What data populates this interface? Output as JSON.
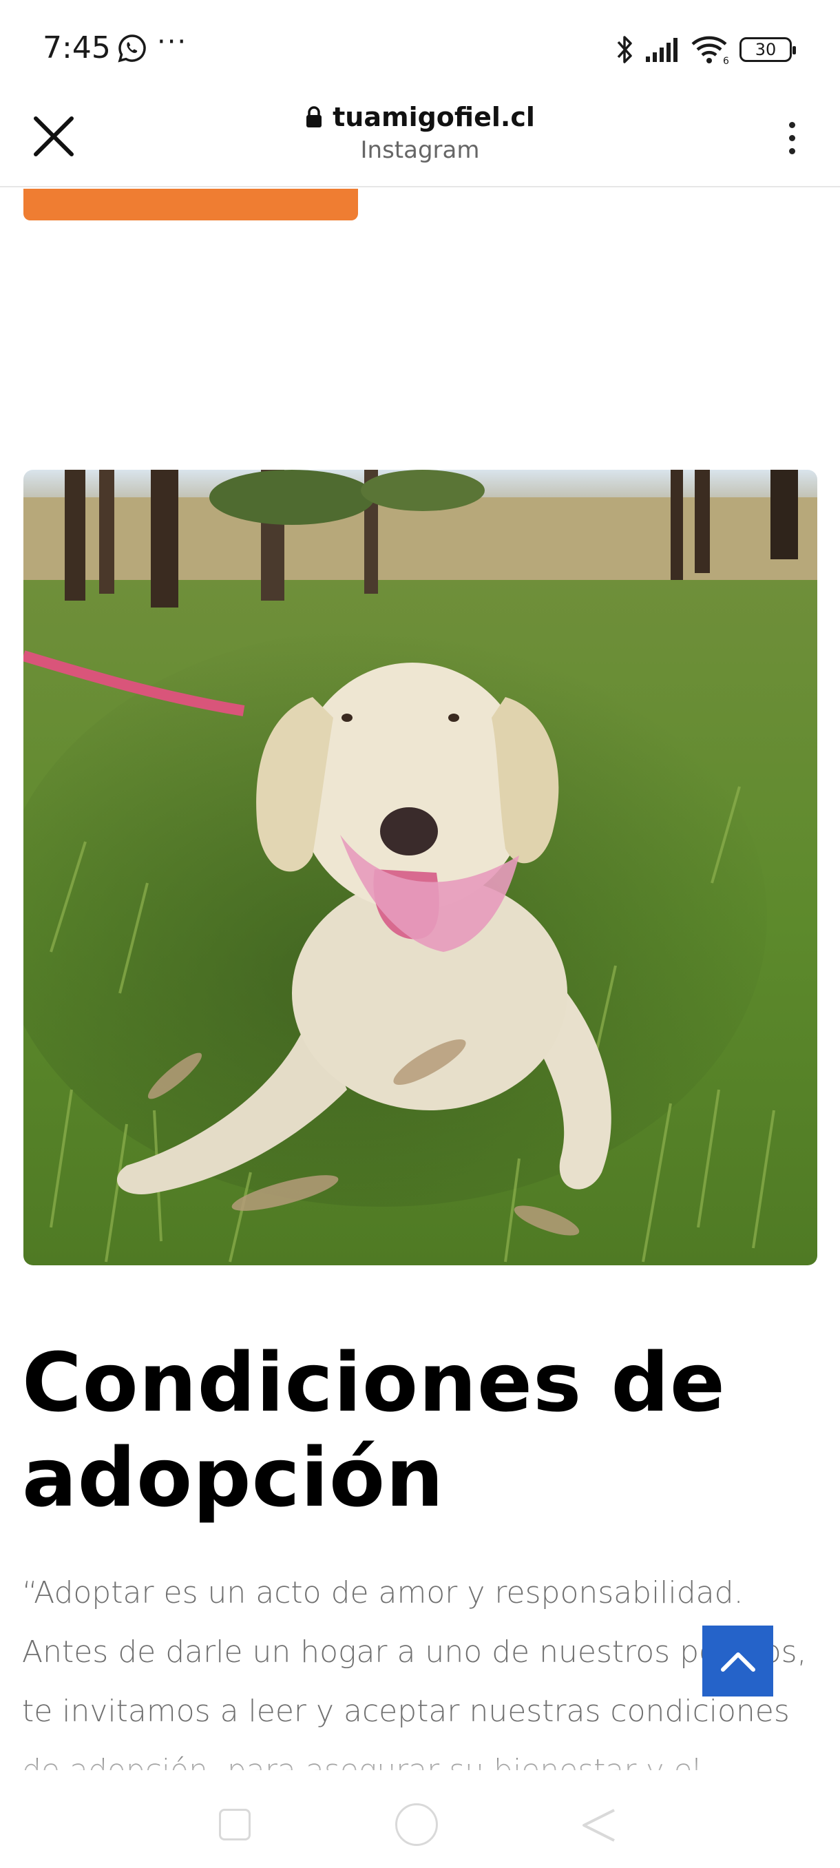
{
  "status_bar": {
    "time": "7:45",
    "dots": "···",
    "battery": "30",
    "network_badge": "6",
    "icons": [
      "whatsapp-icon",
      "bluetooth-icon",
      "signal-icon",
      "wifi-icon",
      "battery-icon"
    ]
  },
  "browser": {
    "url": "tuamigofiel.cl",
    "subtitle": "Instagram",
    "icons": [
      "close-icon",
      "lock-icon",
      "more-vert-icon"
    ]
  },
  "content": {
    "heading": "Condiciones de adopción",
    "body": "“Adoptar es un acto de amor y responsabilidad. Antes de darle un hogar a uno de nuestros perritos, te invitamos a leer y aceptar nuestras condiciones de adopción, para asegurar su bienestar y el"
  },
  "colors": {
    "orange_button": "#ef7d32",
    "scroll_top_button": "#2563c9",
    "body_text": "#707070"
  },
  "nav_icons": [
    "recent-apps-icon",
    "home-icon",
    "back-icon"
  ]
}
